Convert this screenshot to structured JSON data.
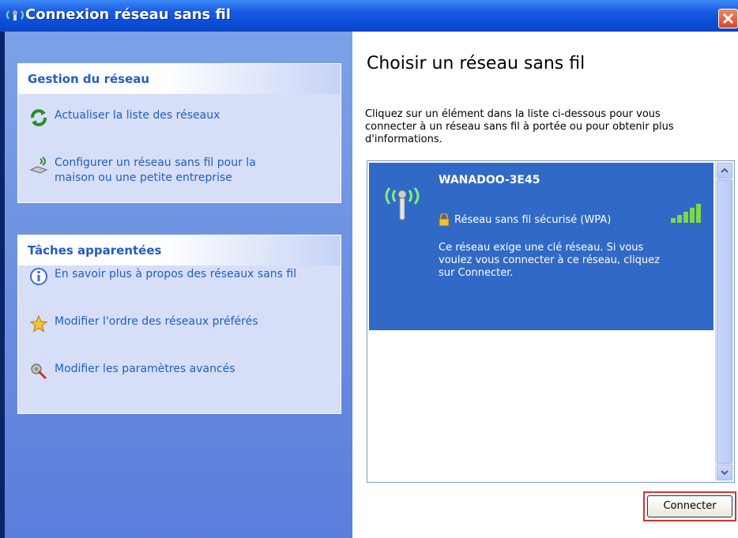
{
  "window": {
    "title": "Connexion réseau sans fil"
  },
  "colors": {
    "titlebar": "#0a4fd8",
    "left_pane": "#6a8ee0",
    "panel_header_text": "#215dc6",
    "selection": "#3169c6",
    "highlight_border": "#e0302a"
  },
  "sidebar": {
    "network_tasks": {
      "header": "Gestion du réseau",
      "items": [
        {
          "label": "Actualiser la liste des réseaux",
          "icon": "refresh-icon"
        },
        {
          "label": "Configurer un réseau sans fil pour la maison ou une petite entreprise",
          "icon": "wireless-setup-icon"
        }
      ]
    },
    "related_tasks": {
      "header": "Tâches apparentées",
      "items": [
        {
          "label": "En savoir plus à propos des réseaux sans fil",
          "icon": "info-icon"
        },
        {
          "label": "Modifier l'ordre des réseaux préférés",
          "icon": "star-icon"
        },
        {
          "label": "Modifier les paramètres avancés",
          "icon": "settings-icon"
        }
      ]
    }
  },
  "main": {
    "title": "Choisir un réseau sans fil",
    "instructions": "Cliquez sur un élément dans la liste ci-dessous pour vous connecter à un réseau sans fil à portée ou pour obtenir plus d'informations.",
    "networks": [
      {
        "name": "WANADOO-3E45",
        "security": "Réseau sans fil sécurisé (WPA)",
        "description": "Ce réseau exige une clé réseau. Si vous voulez vous connecter à ce réseau, cliquez sur Connecter.",
        "selected": true,
        "signal_bars": 5
      }
    ],
    "connect_button": "Connecter"
  }
}
